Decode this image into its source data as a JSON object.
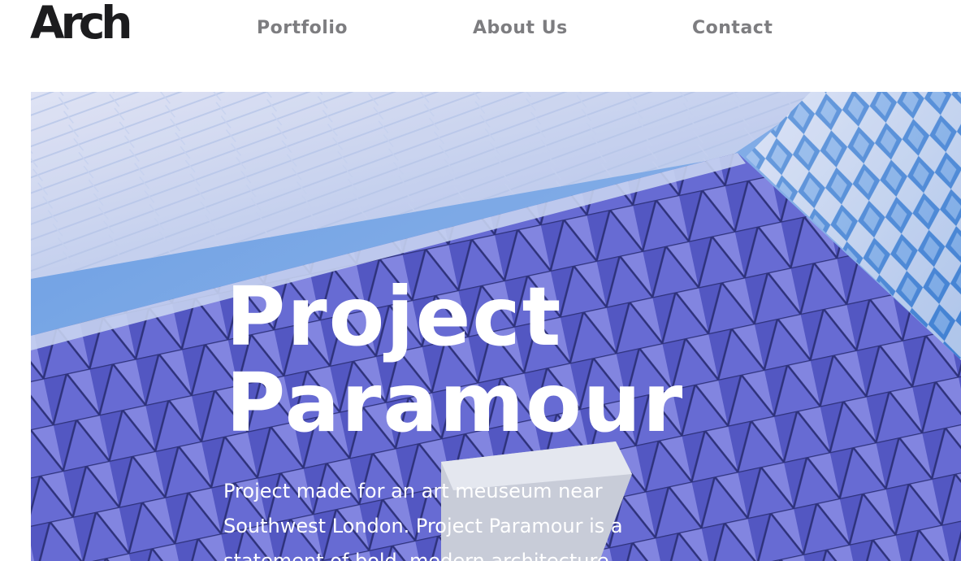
{
  "brand": {
    "logo_text": "Arch"
  },
  "nav": {
    "items": [
      {
        "label": "Portfolio"
      },
      {
        "label": "About Us"
      },
      {
        "label": "Contact"
      }
    ]
  },
  "hero": {
    "title_line1": "Project",
    "title_line2": "Paramour",
    "description": "Project made for an art meuseum near Southwest London. Project Paramour is a statement of bold, modern architecture."
  },
  "colors": {
    "logo": "#1c1c1e",
    "nav_text": "#7d7d80",
    "hero_text": "#ffffff",
    "sky": "#8ab7ec",
    "facade": "#5f62c8"
  },
  "icons": {
    "hero_image": "building-facade-image"
  }
}
